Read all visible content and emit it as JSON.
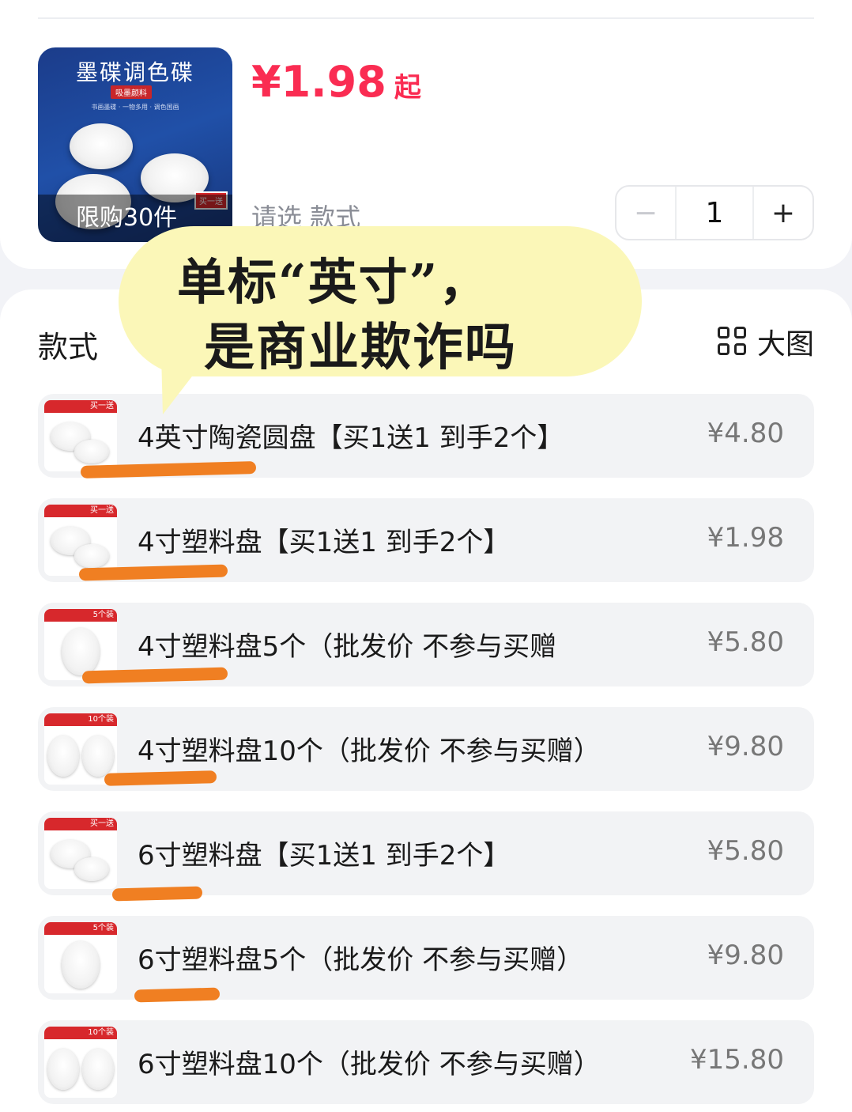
{
  "product": {
    "thumb_title": "墨碟调色碟",
    "thumb_tag": "吸墨颜料",
    "thumb_sub": "书画墨碟 · 一物多用 · 调色国画",
    "thumb_corner": "买一送",
    "limit_label": "限购30件",
    "price": "¥1.98",
    "price_suffix": "起",
    "select_hint": "请选 款式"
  },
  "stepper": {
    "minus": "−",
    "value": "1",
    "plus": "+"
  },
  "annotation": {
    "line1": "单标“英寸”，",
    "line2": "是商业欺诈吗",
    "bg_color": "#fbf7b8",
    "underline_color": "#f07f22"
  },
  "section": {
    "title": "款式",
    "view_toggle": "大图"
  },
  "options": [
    {
      "label": "4英寸陶瓷圆盘【买1送1 到手2个】",
      "price": "¥4.80",
      "badge": "买一送"
    },
    {
      "label": "4寸塑料盘【买1送1 到手2个】",
      "price": "¥1.98",
      "badge": "买一送"
    },
    {
      "label": "4寸塑料盘5个（批发价 不参与买赠",
      "price": "¥5.80",
      "badge": "5个装"
    },
    {
      "label": "4寸塑料盘10个（批发价 不参与买赠）",
      "price": "¥9.80",
      "badge": "10个装"
    },
    {
      "label": "6寸塑料盘【买1送1 到手2个】",
      "price": "¥5.80",
      "badge": "买一送"
    },
    {
      "label": "6寸塑料盘5个（批发价 不参与买赠）",
      "price": "¥9.80",
      "badge": "5个装"
    },
    {
      "label": "6寸塑料盘10个（批发价 不参与买赠）",
      "price": "¥15.80",
      "badge": "10个装"
    }
  ],
  "colors": {
    "price_red": "#fa2c52",
    "option_bg": "#f2f3f5"
  }
}
